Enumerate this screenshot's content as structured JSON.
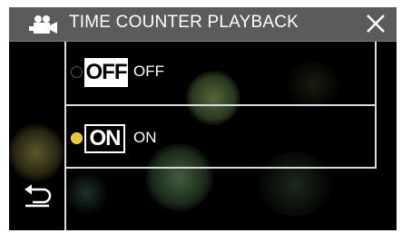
{
  "header": {
    "mode_icon": "video-camera-icon",
    "title": "TIME COUNTER PLAYBACK",
    "close_icon": "close-x-icon"
  },
  "options": [
    {
      "badge": "OFF",
      "label": "OFF",
      "selected": false
    },
    {
      "badge": "ON",
      "label": "ON",
      "selected": true
    }
  ],
  "back_icon": "return-arrow-icon",
  "colors": {
    "header_bg": "#5b5b5b",
    "background": "#000000",
    "selected_radio": "#e8c838",
    "divider": "#dcdcdc"
  }
}
